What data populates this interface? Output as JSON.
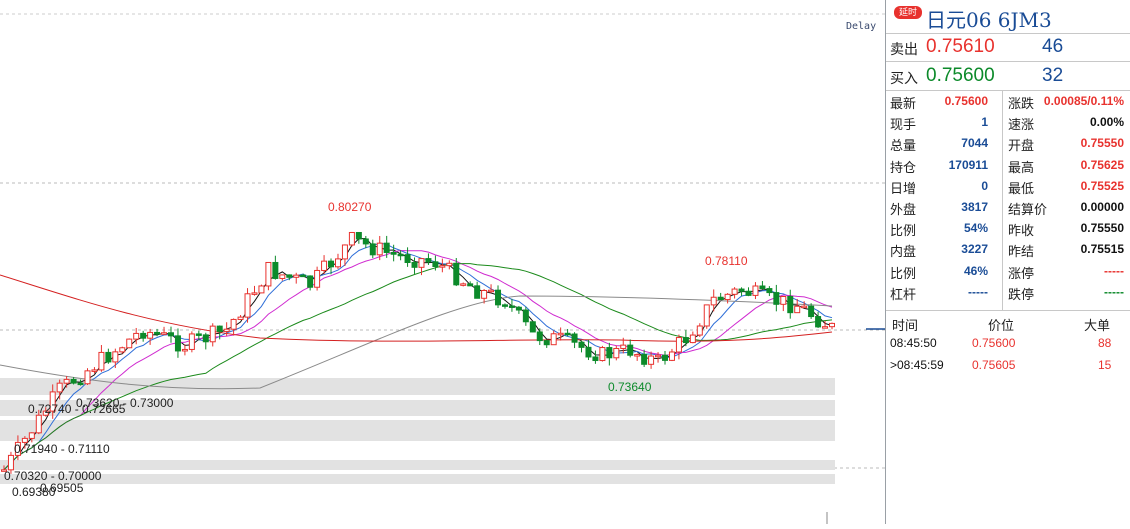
{
  "chart": {
    "delay_label": "Delay",
    "annotations": {
      "high": "0.80270",
      "peak2": "0.78110",
      "low": "0.73640"
    },
    "range_labels": [
      "0.73620 - 0.73000",
      "0.72740 - 0.72665",
      "0.71940 - 0.71110",
      "0.70320 - 0.70000",
      "0.69505",
      "0.69380"
    ],
    "colors": {
      "up": "#e8322e",
      "down": "#0c8a2a",
      "ma_black": "#111111",
      "ma_blue": "#2f6fd8",
      "ma_magenta": "#d02bd0",
      "ma_green": "#1b8a1b",
      "ma_gray": "#8a8a8a",
      "ma_red": "#d42020"
    }
  },
  "panel": {
    "badge": "延时",
    "title": "日元06  6JM3",
    "ask": {
      "label": "卖出",
      "price": "0.75610",
      "volume": "46"
    },
    "bid": {
      "label": "买入",
      "price": "0.75600",
      "volume": "32"
    },
    "left": [
      {
        "k": "最新",
        "v": "0.75600",
        "c": "red"
      },
      {
        "k": "现手",
        "v": "1",
        "c": "blue"
      },
      {
        "k": "总量",
        "v": "7044",
        "c": "blue"
      },
      {
        "k": "持仓",
        "v": "170911",
        "c": "blue"
      },
      {
        "k": "日增",
        "v": "0",
        "c": "blue"
      },
      {
        "k": "外盘",
        "v": "3817",
        "c": "blue"
      },
      {
        "k": "比例",
        "v": "54%",
        "c": "blue"
      },
      {
        "k": "内盘",
        "v": "3227",
        "c": "blue"
      },
      {
        "k": "比例",
        "v": "46%",
        "c": "blue"
      },
      {
        "k": "杠杆",
        "v": "-----",
        "c": "blue"
      }
    ],
    "right": [
      {
        "k": "涨跌",
        "v": "0.00085/0.11%",
        "c": "red"
      },
      {
        "k": "速涨",
        "v": "0.00%",
        "c": "black"
      },
      {
        "k": "开盘",
        "v": "0.75550",
        "c": "red"
      },
      {
        "k": "最高",
        "v": "0.75625",
        "c": "red"
      },
      {
        "k": "最低",
        "v": "0.75525",
        "c": "red"
      },
      {
        "k": "结算价",
        "v": "0.00000",
        "c": "black"
      },
      {
        "k": "昨收",
        "v": "0.75550",
        "c": "black"
      },
      {
        "k": "昨结",
        "v": "0.75515",
        "c": "black"
      },
      {
        "k": "涨停",
        "v": "-----",
        "c": "red"
      },
      {
        "k": "跌停",
        "v": "-----",
        "c": "green"
      }
    ],
    "ticks": {
      "headers": {
        "time": "时间",
        "price": "价位",
        "big": "大单"
      },
      "rows": [
        {
          "time": "08:45:50",
          "price": "0.75600",
          "big": "88"
        },
        {
          "time": ">08:45:59",
          "price": "0.75605",
          "big": "15"
        }
      ]
    }
  }
}
